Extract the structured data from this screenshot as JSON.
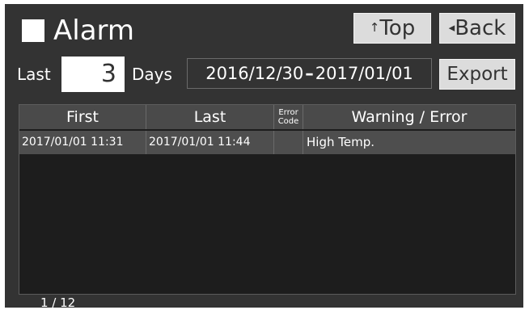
{
  "header": {
    "title": "Alarm",
    "top_button": {
      "arrow": "↑",
      "label": "Top"
    },
    "back_button": {
      "arrow": "◂",
      "label": "Back"
    }
  },
  "filter": {
    "last_label": "Last",
    "days_value": "3",
    "days_label": "Days",
    "range_start": "2016/12/30",
    "range_separator": "–",
    "range_end": "2017/01/01",
    "export_label": "Export"
  },
  "table": {
    "headers": {
      "first": "First",
      "last": "Last",
      "code_line1": "Error",
      "code_line2": "Code",
      "warning": "Warning / Error"
    },
    "rows": [
      {
        "first": "2017/01/01 11:31",
        "last": "2017/01/01 11:44",
        "code": "",
        "warning": "High Temp."
      }
    ]
  },
  "pagination": {
    "text": "1 / 12"
  },
  "colors": {
    "background": "#333333",
    "button": "#dcdcdc",
    "selected_row": "#4e4e4e"
  }
}
